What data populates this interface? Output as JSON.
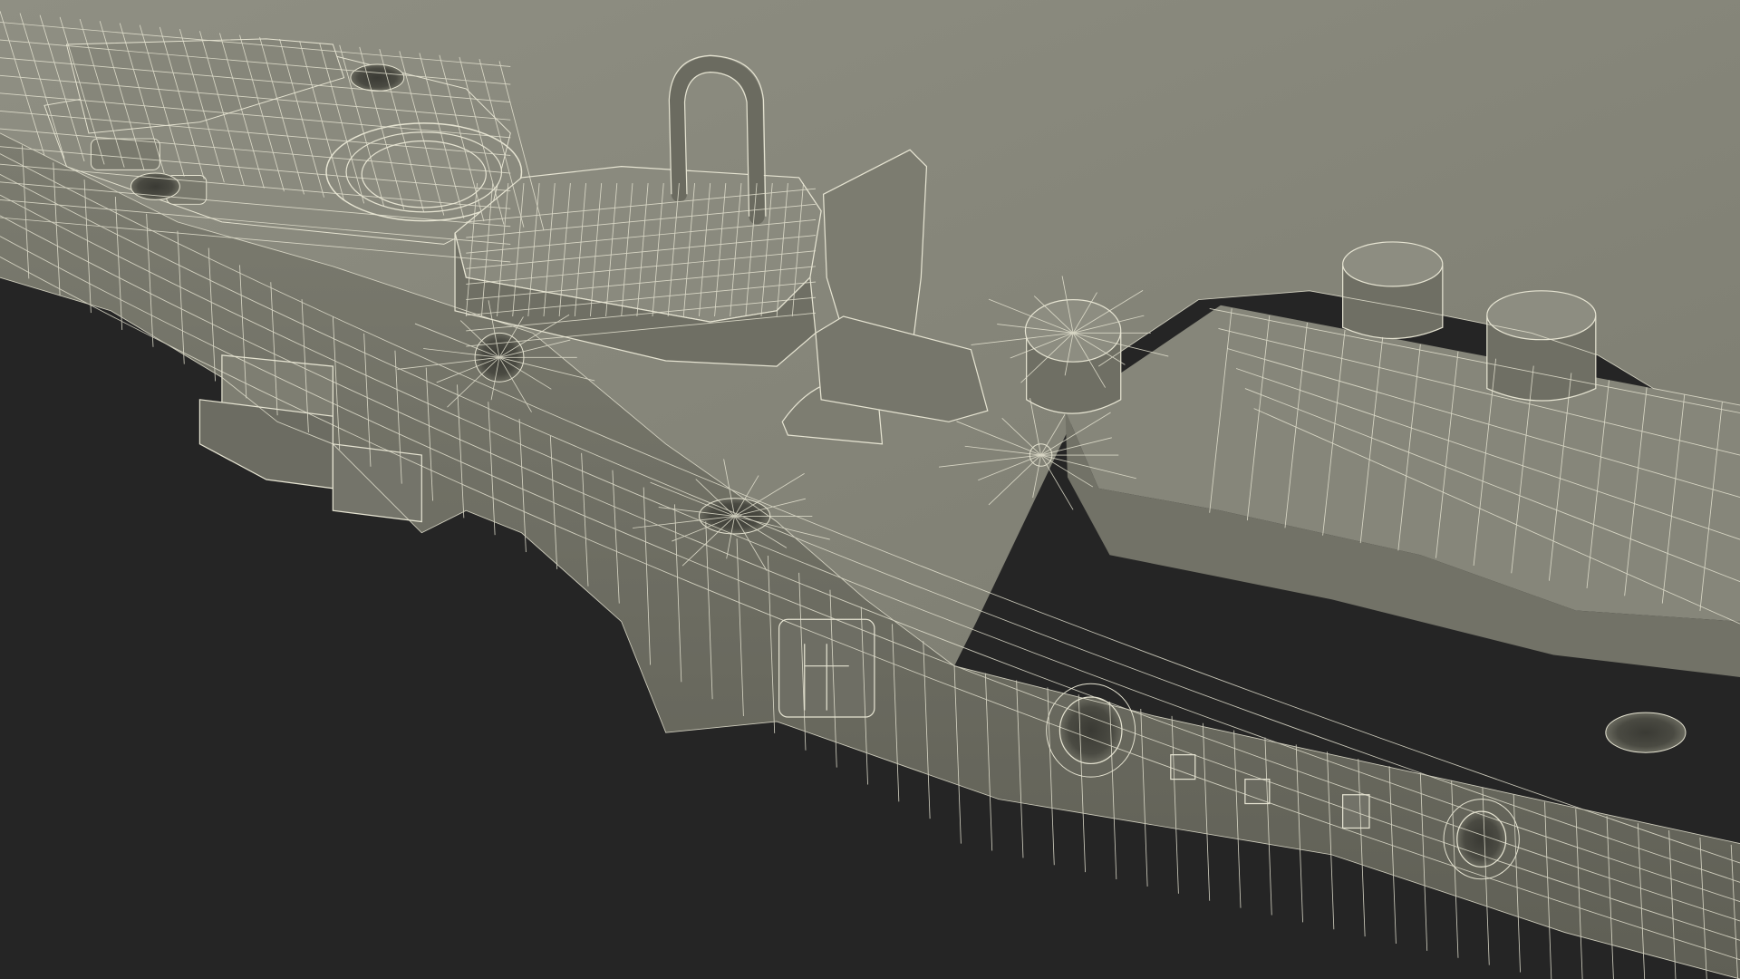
{
  "scene": {
    "subject": "",
    "colors": {
      "background": "#252525",
      "body_base": "#7c7c70",
      "body_light": "#8f8f83",
      "body_top": "#878779",
      "body_dark": "#5f5f55",
      "shadow": "#4a4a42",
      "wire": "#e6e4d2"
    }
  }
}
